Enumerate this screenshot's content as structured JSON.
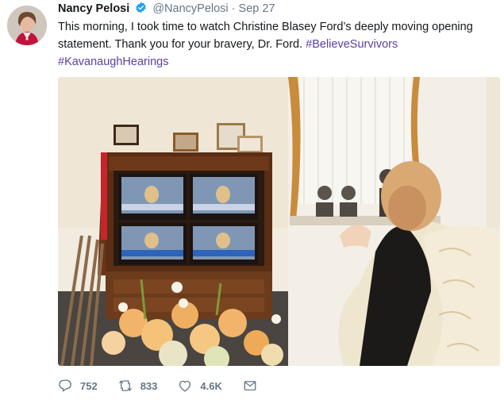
{
  "tweet": {
    "author_name": "Nancy Pelosi",
    "handle": "@NancyPelosi",
    "separator": "·",
    "date": "Sep 27",
    "text_line1": "This morning, I took time to watch Christine Blasey Ford’s deeply moving opening",
    "text_line2_plain": "statement. Thank you for your bravery, Dr. Ford. ",
    "hashtag1": "#BelieveSurvivors",
    "hashtag2": "#KavanaughHearings",
    "hashtag_color": "#5a3fa5",
    "verified_color": "#1da1f2"
  },
  "actions": {
    "reply_count": "752",
    "retweet_count": "833",
    "like_count": "4.6K"
  },
  "icons": [
    "reply-icon",
    "retweet-icon",
    "like-icon",
    "direct-message-icon",
    "verified-badge-icon"
  ]
}
